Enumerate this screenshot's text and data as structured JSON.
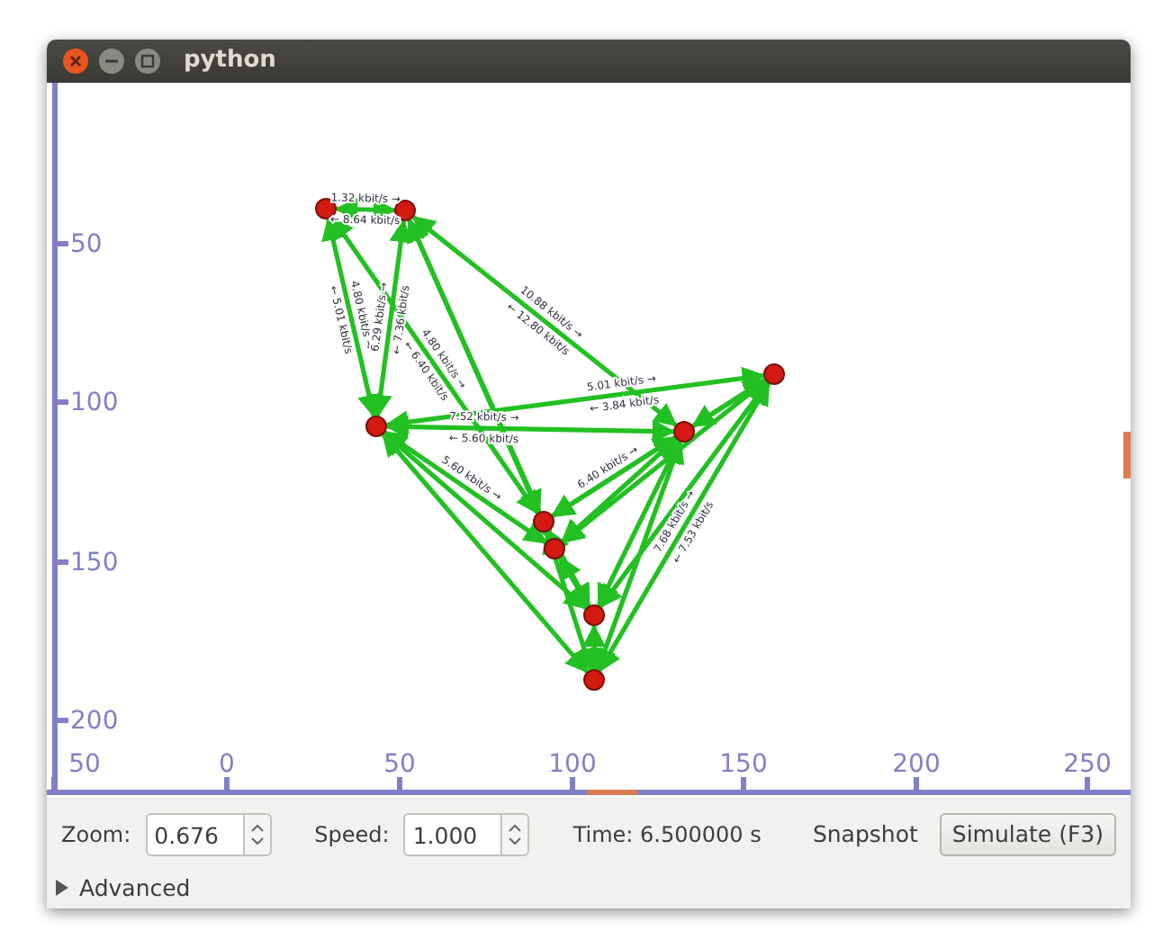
{
  "window": {
    "title": "python"
  },
  "canvas": {
    "y_ruler_labels": [
      "50",
      "100",
      "150",
      "200"
    ],
    "x_ruler_labels": [
      "50",
      "0",
      "50",
      "100",
      "150",
      "200",
      "250"
    ],
    "edge_labels": [
      "1.32 kbit/s →",
      "← 8.64 kbit/s",
      "4.80 kbit/s →",
      "← 5.01 kbit/s",
      "6.29 kbit/s →",
      "← 7.36 kbit/s",
      "4.80 kbit/s →",
      "← 6.40 kbit/s",
      "10.88 kbit/s →",
      "← 12.80 kbit/s",
      "5.01 kbit/s →",
      "← 3.84 kbit/s",
      "7.52 kbit/s →",
      "← 5.60 kbit/s",
      "5.60 kbit/s →",
      "6.40 kbit/s →",
      "7.68 kbit/s →",
      "← 7.53 kbit/s"
    ]
  },
  "controls": {
    "zoom_label": "Zoom:",
    "zoom_value": "0.676",
    "speed_label": "Speed:",
    "speed_value": "1.000",
    "time": "Time: 6.500000 s",
    "snapshot": "Snapshot",
    "simulate": "Simulate (F3)"
  },
  "advanced": {
    "label": "Advanced",
    "expanded": false
  }
}
